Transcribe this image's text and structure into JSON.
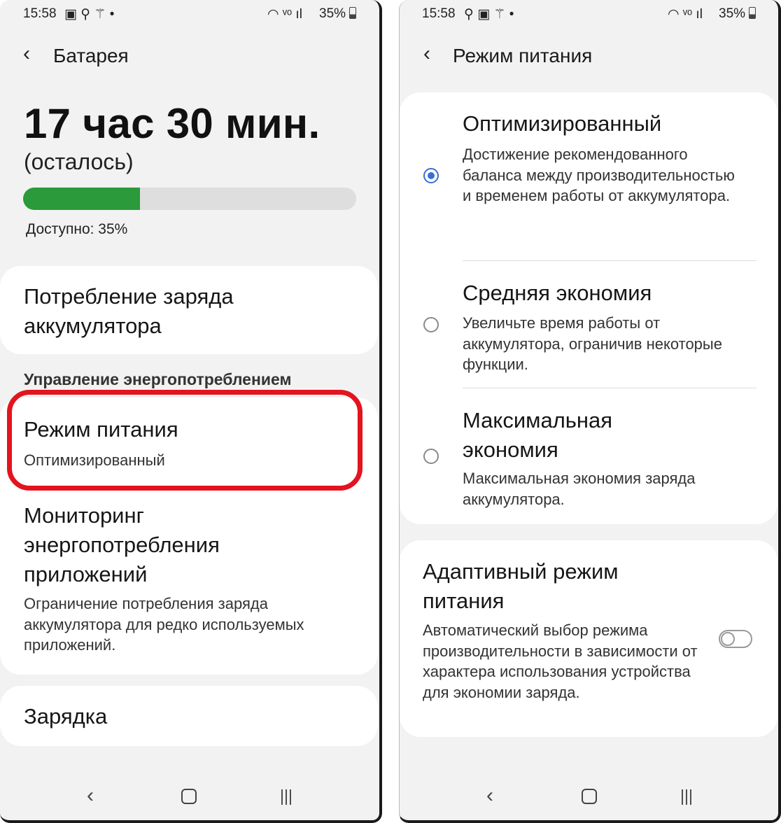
{
  "left": {
    "status": {
      "time": "15:58",
      "icons_left": "▣ ⚲ ⚚ •",
      "icons_right": "◠ ᵛᵒ ıl",
      "battery": "35%"
    },
    "appbar": {
      "title": "Батарея"
    },
    "battery": {
      "time_left": "17 час 30 мин.",
      "remaining_label": "(осталось)",
      "available": "Доступно: 35%",
      "level_percent": 35,
      "bar_color": "#2a9a3a"
    },
    "usage_item": "Потребление заряда аккумулятора",
    "section_header": "Управление энергопотреблением",
    "power_mode": {
      "title": "Режим питания",
      "value": "Оптимизированный",
      "highlight_color": "#e3141e"
    },
    "monitoring": {
      "title": "Мониторинг энергопотребления приложений",
      "description": "Ограничение потребления заряда аккумулятора для редко используемых приложений."
    },
    "charging": "Зарядка"
  },
  "right": {
    "status": {
      "time": "15:58",
      "icons_left": "⚲ ▣ ⚚ •",
      "icons_right": "◠ ᵛᵒ ıl",
      "battery": "35%"
    },
    "appbar": {
      "title": "Режим питания"
    },
    "options": [
      {
        "title": "Оптимизированный",
        "description": "Достижение рекомендованного баланса между производительностью и временем работы от аккумулятора.",
        "selected": true
      },
      {
        "title": "Средняя экономия",
        "description": "Увеличьте время работы от аккумулятора, ограничив некоторые функции.",
        "selected": false
      },
      {
        "title": "Максимальная экономия",
        "description": "Максимальная экономия заряда аккумулятора.",
        "selected": false
      }
    ],
    "adaptive": {
      "title": "Адаптивный режим питания",
      "description": "Автоматический выбор режима производительности в зависимости от характера использования устройства для экономии заряда.",
      "enabled": false
    }
  },
  "navbar": {
    "back": "‹",
    "home": "○",
    "recents": "|||"
  },
  "colors": {
    "accent": "#3a6fd8",
    "background": "#f2f2f2",
    "card": "#ffffff"
  }
}
